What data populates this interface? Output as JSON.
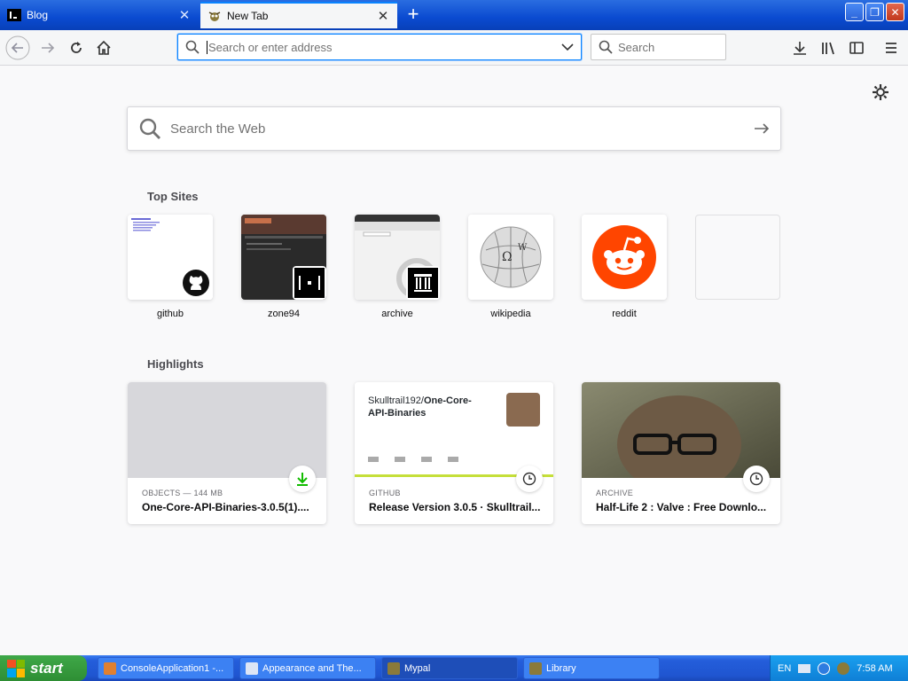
{
  "tabs": [
    {
      "label": "Blog",
      "active": false
    },
    {
      "label": "New Tab",
      "active": true
    }
  ],
  "urlbar": {
    "placeholder": "Search or enter address"
  },
  "searchbar": {
    "placeholder": "Search"
  },
  "web_search": {
    "placeholder": "Search the Web"
  },
  "top_sites": {
    "title": "Top Sites",
    "items": [
      {
        "label": "github"
      },
      {
        "label": "zone94"
      },
      {
        "label": "archive"
      },
      {
        "label": "wikipedia"
      },
      {
        "label": "reddit"
      },
      {
        "label": ""
      }
    ]
  },
  "highlights": {
    "title": "Highlights",
    "cards": [
      {
        "meta": "OBJECTS — 144 MB",
        "title": "One-Core-API-Binaries-3.0.5(1)...."
      },
      {
        "meta": "GITHUB",
        "title": "Release Version 3.0.5 · Skulltrail...",
        "thumb_line1": "Skulltrail192/",
        "thumb_bold": "One-Core-",
        "thumb_line2": "API-Binaries"
      },
      {
        "meta": "ARCHIVE",
        "title": "Half-Life 2 : Valve : Free Downlo..."
      }
    ]
  },
  "taskbar": {
    "start_label": "start",
    "tasks": [
      {
        "label": "ConsoleApplication1 -..."
      },
      {
        "label": "Appearance and The..."
      },
      {
        "label": "Mypal"
      },
      {
        "label": "Library"
      }
    ],
    "tray": {
      "lang": "EN",
      "clock": "7:58 AM"
    }
  },
  "colors": {
    "accent": "#0a84ff",
    "reddit": "#ff4500",
    "xp_blue": "#245edb",
    "start_green": "#3fa848"
  }
}
